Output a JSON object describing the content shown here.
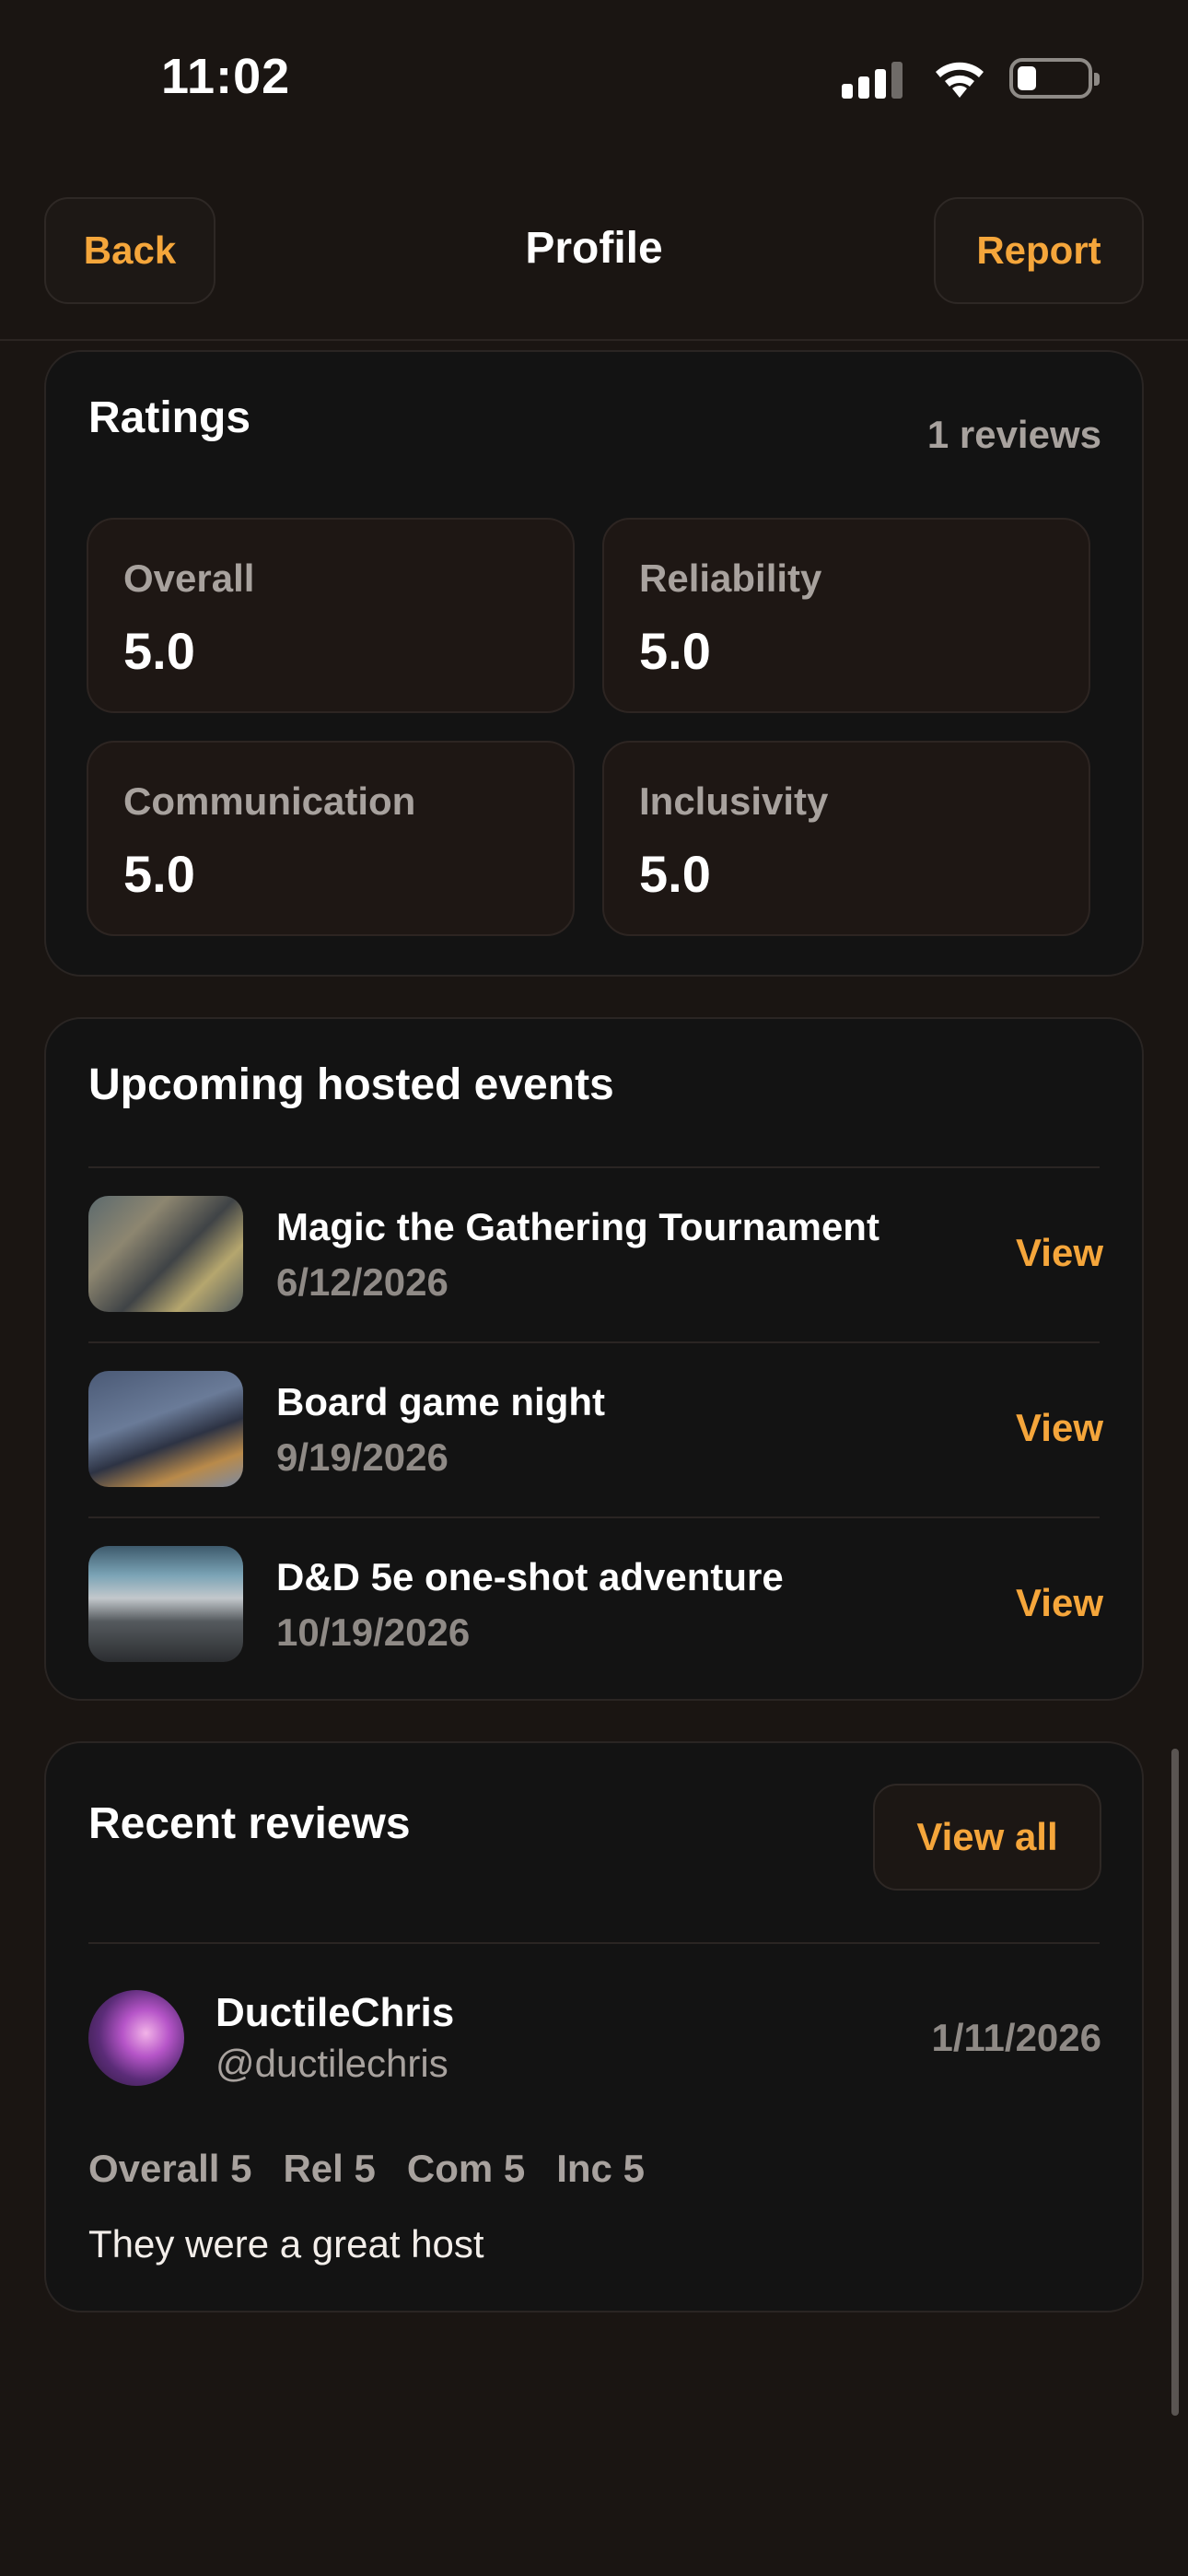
{
  "status": {
    "time": "11:02",
    "battery_level": 0.2
  },
  "nav": {
    "back": "Back",
    "title": "Profile",
    "report": "Report"
  },
  "ratings": {
    "title": "Ratings",
    "count": "1 reviews",
    "items": [
      {
        "label": "Overall",
        "value": "5.0"
      },
      {
        "label": "Reliability",
        "value": "5.0"
      },
      {
        "label": "Communication",
        "value": "5.0"
      },
      {
        "label": "Inclusivity",
        "value": "5.0"
      }
    ]
  },
  "events": {
    "title": "Upcoming hosted events",
    "view_label": "View",
    "items": [
      {
        "name": "Magic the Gathering Tournament",
        "date": "6/12/2026"
      },
      {
        "name": "Board game night",
        "date": "9/19/2026"
      },
      {
        "name": "D&D 5e one-shot adventure",
        "date": "10/19/2026"
      }
    ]
  },
  "reviews": {
    "title": "Recent reviews",
    "view_all": "View all",
    "items": [
      {
        "name": "DuctileChris",
        "handle": "@ductilechris",
        "date": "1/11/2026",
        "scores": [
          "Overall 5",
          "Rel 5",
          "Com 5",
          "Inc 5"
        ],
        "text": "They were a great host"
      }
    ]
  }
}
